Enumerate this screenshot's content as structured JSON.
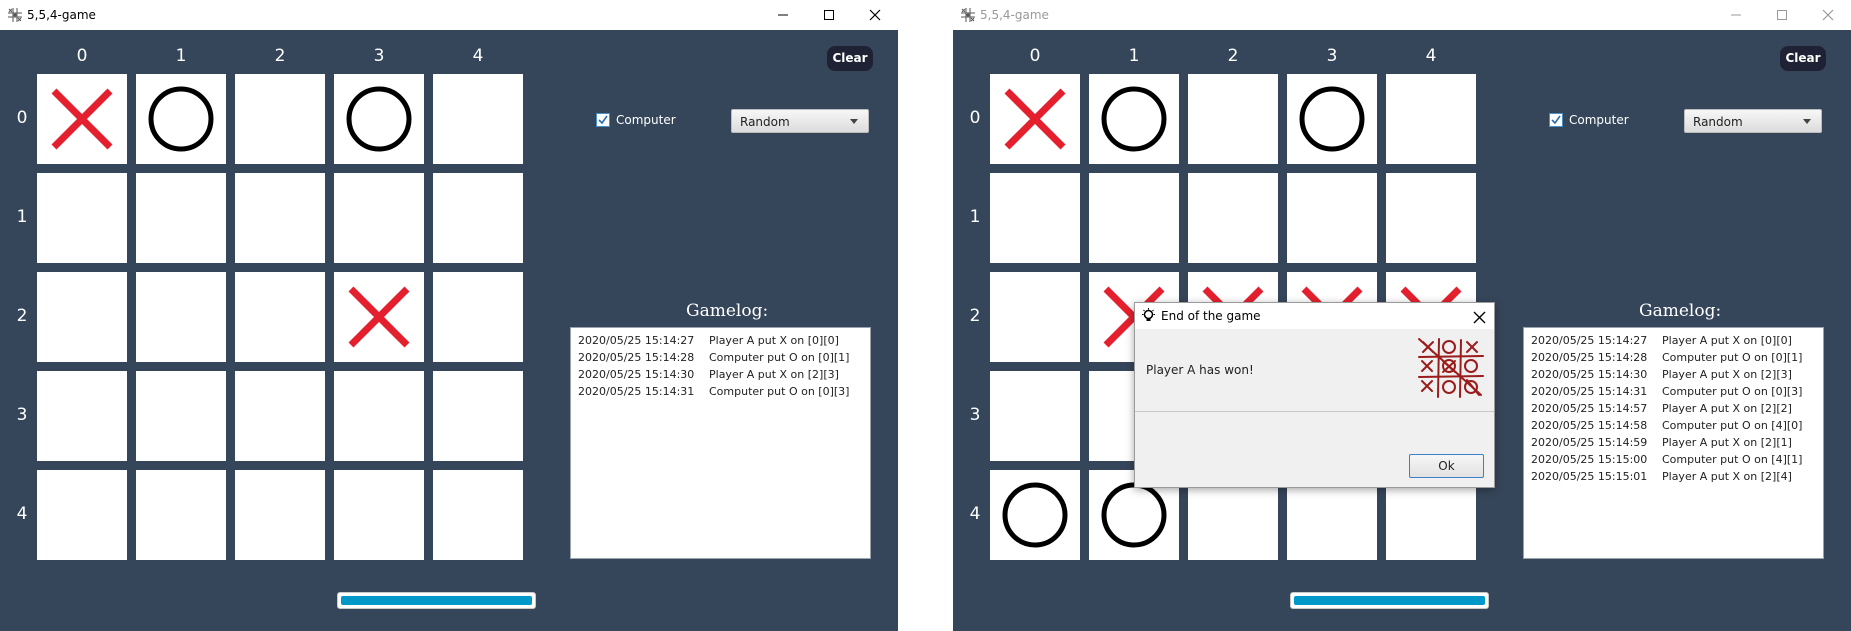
{
  "windows": [
    {
      "title": "5,5,4-game",
      "active": true,
      "column_headers": [
        "0",
        "1",
        "2",
        "3",
        "4"
      ],
      "row_headers": [
        "0",
        "1",
        "2",
        "3",
        "4"
      ],
      "board": [
        [
          "X",
          "O",
          "",
          "O",
          ""
        ],
        [
          "",
          "",
          "",
          "",
          ""
        ],
        [
          "",
          "",
          "",
          "X",
          ""
        ],
        [
          "",
          "",
          "",
          "",
          ""
        ],
        [
          "",
          "",
          "",
          "",
          ""
        ]
      ],
      "clear_label": "Clear",
      "computer_label": "Computer",
      "computer_checked": true,
      "mode_selected": "Random",
      "gamelog_title": "Gamelog:",
      "gamelog": [
        {
          "time": "2020/05/25 15:14:27",
          "msg": "Player A put X on [0][0]"
        },
        {
          "time": "2020/05/25 15:14:28",
          "msg": "Computer put O on [0][1]"
        },
        {
          "time": "2020/05/25 15:14:30",
          "msg": "Player A put X on [2][3]"
        },
        {
          "time": "2020/05/25 15:14:31",
          "msg": "Computer put O on [0][3]"
        }
      ],
      "progress": 1.0
    },
    {
      "title": "5,5,4-game",
      "active": false,
      "column_headers": [
        "0",
        "1",
        "2",
        "3",
        "4"
      ],
      "row_headers": [
        "0",
        "1",
        "2",
        "3",
        "4"
      ],
      "board": [
        [
          "X",
          "O",
          "",
          "O",
          ""
        ],
        [
          "",
          "",
          "",
          "",
          ""
        ],
        [
          "",
          "X",
          "X",
          "X",
          "X"
        ],
        [
          "",
          "",
          "",
          "",
          ""
        ],
        [
          "O",
          "O",
          "",
          "",
          ""
        ]
      ],
      "clear_label": "Clear",
      "computer_label": "Computer",
      "computer_checked": true,
      "mode_selected": "Random",
      "gamelog_title": "Gamelog:",
      "gamelog": [
        {
          "time": "2020/05/25 15:14:27",
          "msg": "Player A put X on [0][0]"
        },
        {
          "time": "2020/05/25 15:14:28",
          "msg": "Computer put O on [0][1]"
        },
        {
          "time": "2020/05/25 15:14:30",
          "msg": "Player A put X on [2][3]"
        },
        {
          "time": "2020/05/25 15:14:31",
          "msg": "Computer put O on [0][3]"
        },
        {
          "time": "2020/05/25 15:14:57",
          "msg": "Player A put X on [2][2]"
        },
        {
          "time": "2020/05/25 15:14:58",
          "msg": "Computer put O on [4][0]"
        },
        {
          "time": "2020/05/25 15:14:59",
          "msg": "Player A put X on [2][1]"
        },
        {
          "time": "2020/05/25 15:15:00",
          "msg": "Computer put O on [4][1]"
        },
        {
          "time": "2020/05/25 15:15:01",
          "msg": "Player A put X on [2][4]"
        }
      ],
      "progress": 1.0
    }
  ],
  "dialog": {
    "title": "End of the game",
    "message": "Player A has won!",
    "ok_label": "Ok"
  },
  "colors": {
    "background": "#36465a",
    "x_mark": "#e5202e",
    "o_mark": "#000000",
    "progress": "#0097c9",
    "clear_button": "#1f2234"
  },
  "icons": {
    "app": "tic-tac-toe-grid-icon",
    "dialog": "bulb-icon",
    "dialog_image": "tic-tac-toe-doodle-image"
  }
}
